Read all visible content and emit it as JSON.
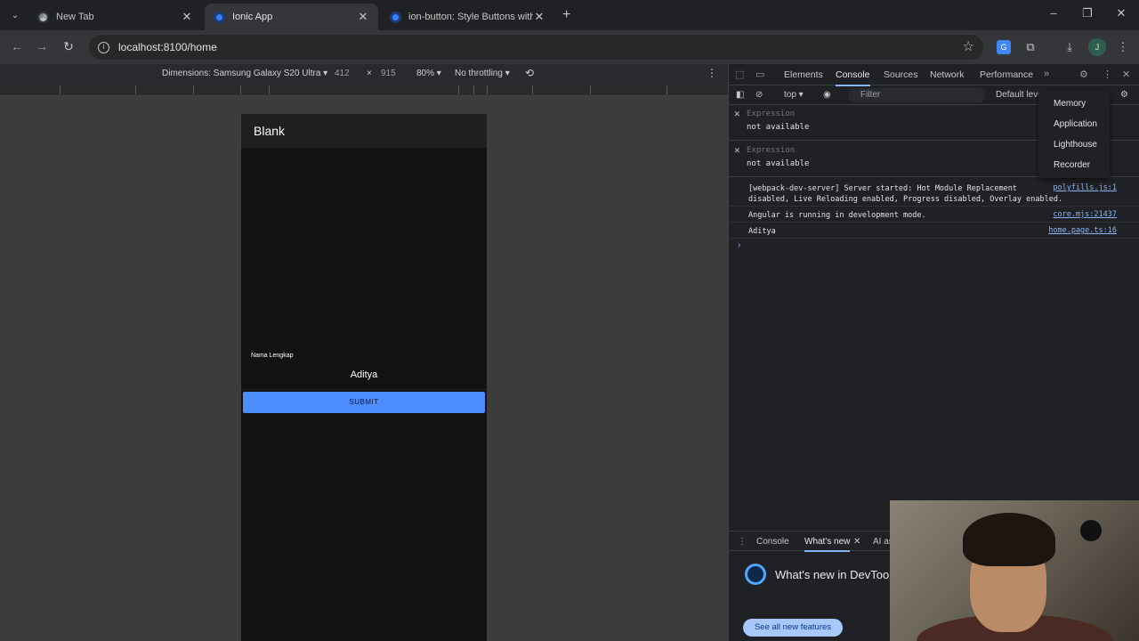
{
  "tabs": [
    {
      "title": "New Tab",
      "favicon": "chrome-icon"
    },
    {
      "title": "Ionic App",
      "favicon": "ionic-icon",
      "active": true
    },
    {
      "title": "ion-button: Style Buttons with C",
      "favicon": "ionic-icon"
    }
  ],
  "address": {
    "url": "localhost:8100/home"
  },
  "device_toolbar": {
    "dimensions": "Dimensions: Samsung Galaxy S20 Ultra ▾",
    "width": "412",
    "times": "×",
    "height": "915",
    "zoom": "80% ▾",
    "throttling": "No throttling ▾"
  },
  "app": {
    "header_title": "Blank",
    "field_label": "Nama Lengkap",
    "field_value": "Aditya",
    "submit_label": "SUBMIT"
  },
  "devtools": {
    "tabs": [
      "Elements",
      "Console",
      "Sources",
      "Network",
      "Performance"
    ],
    "active_tab": "Console",
    "context": "top ▾",
    "filter_placeholder": "Filter",
    "levels": "Default leve",
    "expressions": [
      {
        "label": "Expression",
        "value": "not available"
      },
      {
        "label": "Expression",
        "value": "not available"
      }
    ],
    "logs": [
      {
        "message_line1": "[webpack-dev-server] Server started: Hot Module Replacement",
        "message_line2": "disabled, Live Reloading enabled, Progress disabled, Overlay enabled.",
        "source": "polyfills.js:1"
      },
      {
        "message_line1": "Angular is running in development mode.",
        "source": "core.mjs:21437"
      },
      {
        "message_line1": "Aditya",
        "source": "home.page.ts:16"
      }
    ],
    "prompt": "›",
    "overflow_menu": [
      "Memory",
      "Application",
      "Lighthouse",
      "Recorder"
    ],
    "drawer": {
      "tabs": [
        "Console",
        "What's new",
        "AI as"
      ],
      "active_tab": "What's new",
      "title": "What's new in DevToo",
      "button": "See all new features"
    }
  }
}
